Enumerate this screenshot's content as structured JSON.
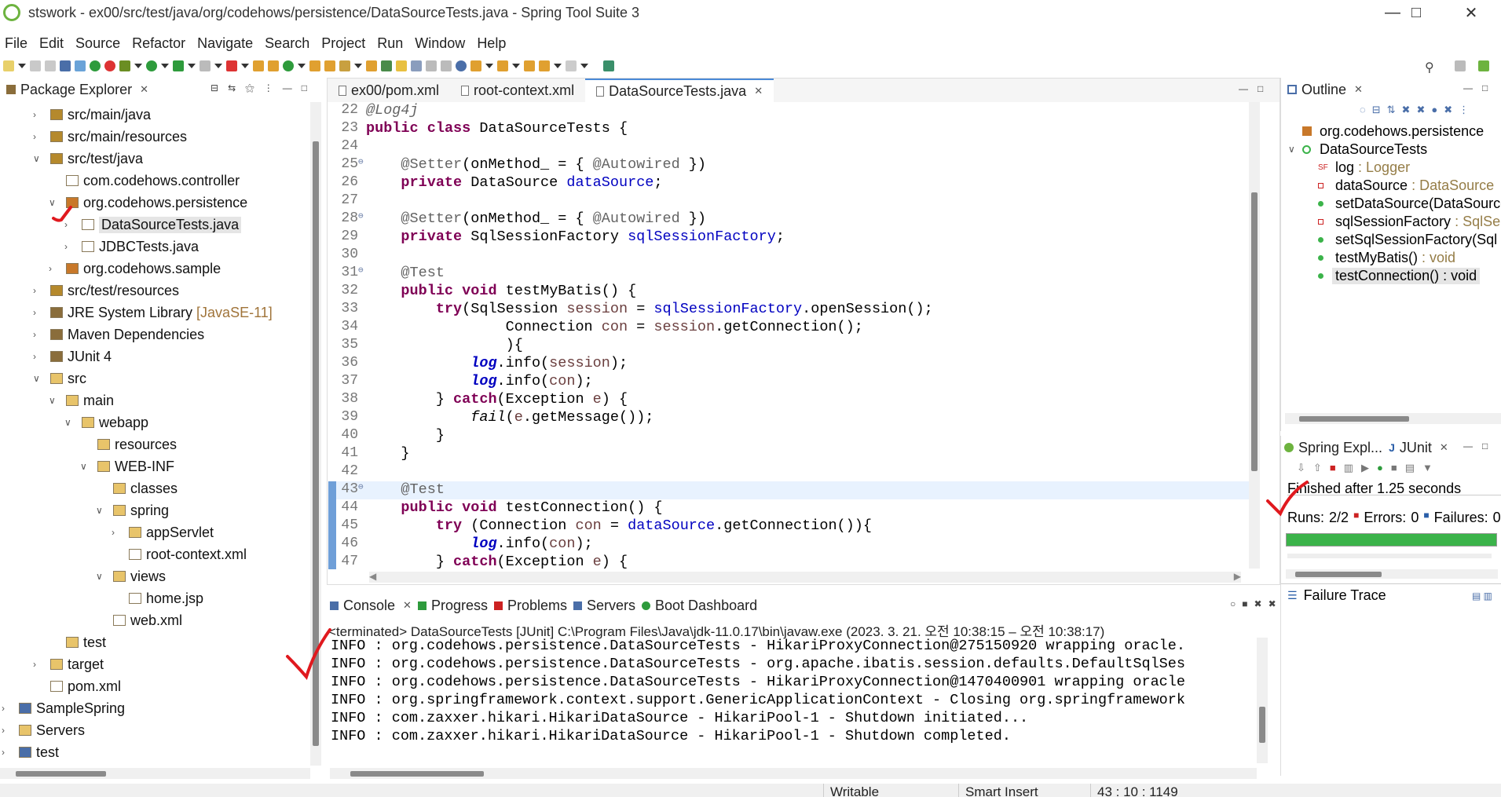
{
  "window": {
    "title": "stswork - ex00/src/test/java/org/codehows/persistence/DataSourceTests.java - Spring Tool Suite 3"
  },
  "menu": [
    "File",
    "Edit",
    "Source",
    "Refactor",
    "Navigate",
    "Search",
    "Project",
    "Run",
    "Window",
    "Help"
  ],
  "package_explorer": {
    "tab_label": "Package Explorer",
    "items": [
      {
        "label": "src/main/java",
        "indent": 1,
        "expand": "closed",
        "icon": "source-folder-icon"
      },
      {
        "label": "src/main/resources",
        "indent": 1,
        "expand": "closed",
        "icon": "source-folder-icon"
      },
      {
        "label": "src/test/java",
        "indent": 1,
        "expand": "open",
        "icon": "source-folder-icon"
      },
      {
        "label": "com.codehows.controller",
        "indent": 2,
        "expand": "none",
        "icon": "empty-package-icon"
      },
      {
        "label": "org.codehows.persistence",
        "indent": 2,
        "expand": "open",
        "icon": "package-icon"
      },
      {
        "label": "DataSourceTests.java",
        "indent": 3,
        "expand": "closed",
        "icon": "java-file-icon",
        "selected": true
      },
      {
        "label": "JDBCTests.java",
        "indent": 3,
        "expand": "closed",
        "icon": "java-file-icon"
      },
      {
        "label": "org.codehows.sample",
        "indent": 2,
        "expand": "closed",
        "icon": "package-icon"
      },
      {
        "label": "src/test/resources",
        "indent": 1,
        "expand": "closed",
        "icon": "source-folder-icon"
      },
      {
        "label": "JRE System Library",
        "decoration": "[JavaSE-11]",
        "indent": 1,
        "expand": "closed",
        "icon": "library-icon"
      },
      {
        "label": "Maven Dependencies",
        "indent": 1,
        "expand": "closed",
        "icon": "library-icon"
      },
      {
        "label": "JUnit 4",
        "indent": 1,
        "expand": "closed",
        "icon": "library-icon"
      },
      {
        "label": "src",
        "indent": 1,
        "expand": "open",
        "icon": "folder-icon"
      },
      {
        "label": "main",
        "indent": 2,
        "expand": "open",
        "icon": "folder-icon"
      },
      {
        "label": "webapp",
        "indent": 3,
        "expand": "open",
        "icon": "folder-icon"
      },
      {
        "label": "resources",
        "indent": 4,
        "expand": "none",
        "icon": "folder-icon"
      },
      {
        "label": "WEB-INF",
        "indent": 4,
        "expand": "open",
        "icon": "folder-icon"
      },
      {
        "label": "classes",
        "indent": 5,
        "expand": "none",
        "icon": "folder-icon"
      },
      {
        "label": "spring",
        "indent": 5,
        "expand": "open",
        "icon": "folder-icon"
      },
      {
        "label": "appServlet",
        "indent": 6,
        "expand": "closed",
        "icon": "folder-icon"
      },
      {
        "label": "root-context.xml",
        "indent": 6,
        "expand": "none",
        "icon": "xml-file-icon"
      },
      {
        "label": "views",
        "indent": 5,
        "expand": "open",
        "icon": "folder-icon"
      },
      {
        "label": "home.jsp",
        "indent": 6,
        "expand": "none",
        "icon": "jsp-file-icon"
      },
      {
        "label": "web.xml",
        "indent": 5,
        "expand": "none",
        "icon": "xml-file-icon"
      },
      {
        "label": "test",
        "indent": 2,
        "expand": "none",
        "icon": "folder-icon"
      },
      {
        "label": "target",
        "indent": 1,
        "expand": "closed",
        "icon": "folder-icon"
      },
      {
        "label": "pom.xml",
        "indent": 1,
        "expand": "none",
        "icon": "xml-file-icon"
      },
      {
        "label": "SampleSpring",
        "indent": 0,
        "expand": "closed",
        "icon": "project-icon"
      },
      {
        "label": "Servers",
        "indent": 0,
        "expand": "closed",
        "icon": "folder-icon"
      },
      {
        "label": "test",
        "indent": 0,
        "expand": "closed",
        "icon": "project-icon"
      }
    ]
  },
  "editor": {
    "tabs": [
      {
        "label": "ex00/pom.xml",
        "icon": "xml-file-icon"
      },
      {
        "label": "root-context.xml",
        "icon": "xml-file-icon"
      },
      {
        "label": "DataSourceTests.java",
        "icon": "java-file-icon",
        "active": true
      }
    ],
    "lines": [
      {
        "n": "22",
        "fold": "",
        "parts": [
          [
            "ann ital",
            "@Log4j"
          ]
        ]
      },
      {
        "n": "23",
        "fold": "",
        "parts": [
          [
            "kw",
            "public"
          ],
          [
            "",
            "&nbsp;"
          ],
          [
            "kw",
            "class"
          ],
          [
            "",
            "&nbsp;DataSourceTests {"
          ]
        ]
      },
      {
        "n": "24",
        "fold": "",
        "parts": []
      },
      {
        "n": "25",
        "fold": "⊖",
        "parts": [
          [
            "",
            "    "
          ],
          [
            "ann",
            "@Setter"
          ],
          [
            "",
            "(onMethod_ = { "
          ],
          [
            "ann",
            "@Autowired"
          ],
          [
            "",
            " })"
          ]
        ]
      },
      {
        "n": "26",
        "fold": "",
        "parts": [
          [
            "",
            "    "
          ],
          [
            "kw",
            "private"
          ],
          [
            "",
            " DataSource "
          ],
          [
            "fld",
            "dataSource"
          ],
          [
            "",
            ";"
          ]
        ]
      },
      {
        "n": "27",
        "fold": "",
        "parts": []
      },
      {
        "n": "28",
        "fold": "⊖",
        "parts": [
          [
            "",
            "    "
          ],
          [
            "ann",
            "@Setter"
          ],
          [
            "",
            "(onMethod_ = { "
          ],
          [
            "ann",
            "@Autowired"
          ],
          [
            "",
            " })"
          ]
        ]
      },
      {
        "n": "29",
        "fold": "",
        "parts": [
          [
            "",
            "    "
          ],
          [
            "kw",
            "private"
          ],
          [
            "",
            " SqlSessionFactory "
          ],
          [
            "fld",
            "sqlSessionFactory"
          ],
          [
            "",
            ";"
          ]
        ]
      },
      {
        "n": "30",
        "fold": "",
        "parts": []
      },
      {
        "n": "31",
        "fold": "⊖",
        "parts": [
          [
            "",
            "    "
          ],
          [
            "ann",
            "@Test"
          ]
        ]
      },
      {
        "n": "32",
        "fold": "",
        "parts": [
          [
            "",
            "    "
          ],
          [
            "kw",
            "public"
          ],
          [
            "",
            " "
          ],
          [
            "kw",
            "void"
          ],
          [
            "",
            " testMyBatis() {"
          ]
        ]
      },
      {
        "n": "33",
        "fold": "",
        "parts": [
          [
            "",
            "        "
          ],
          [
            "kw",
            "try"
          ],
          [
            "",
            "(SqlSession "
          ],
          [
            "local",
            "session"
          ],
          [
            "",
            " = "
          ],
          [
            "fld",
            "sqlSessionFactory"
          ],
          [
            "",
            ".openSession();"
          ]
        ]
      },
      {
        "n": "34",
        "fold": "",
        "parts": [
          [
            "",
            "                Connection "
          ],
          [
            "local",
            "con"
          ],
          [
            "",
            " = "
          ],
          [
            "local",
            "session"
          ],
          [
            "",
            ".getConnection();"
          ]
        ]
      },
      {
        "n": "35",
        "fold": "",
        "parts": [
          [
            "",
            "                ){"
          ]
        ]
      },
      {
        "n": "36",
        "fold": "",
        "parts": [
          [
            "",
            "            "
          ],
          [
            "stat",
            "log"
          ],
          [
            "",
            ".info("
          ],
          [
            "local",
            "session"
          ],
          [
            "",
            ");"
          ]
        ]
      },
      {
        "n": "37",
        "fold": "",
        "parts": [
          [
            "",
            "            "
          ],
          [
            "stat",
            "log"
          ],
          [
            "",
            ".info("
          ],
          [
            "local",
            "con"
          ],
          [
            "",
            ");"
          ]
        ]
      },
      {
        "n": "38",
        "fold": "",
        "parts": [
          [
            "",
            "        } "
          ],
          [
            "kw",
            "catch"
          ],
          [
            "",
            "(Exception "
          ],
          [
            "local",
            "e"
          ],
          [
            "",
            ") {"
          ]
        ]
      },
      {
        "n": "39",
        "fold": "",
        "parts": [
          [
            "",
            "            "
          ],
          [
            "ital",
            "fail"
          ],
          [
            "",
            "("
          ],
          [
            "local",
            "e"
          ],
          [
            "",
            ".getMessage());"
          ]
        ]
      },
      {
        "n": "40",
        "fold": "",
        "parts": [
          [
            "",
            "        }"
          ]
        ]
      },
      {
        "n": "41",
        "fold": "",
        "parts": [
          [
            "",
            "    }"
          ]
        ]
      },
      {
        "n": "42",
        "fold": "",
        "parts": []
      },
      {
        "n": "43",
        "fold": "⊖",
        "current": true,
        "parts": [
          [
            "",
            "    "
          ],
          [
            "ann",
            "@Test"
          ]
        ]
      },
      {
        "n": "44",
        "fold": "",
        "parts": [
          [
            "",
            "    "
          ],
          [
            "kw",
            "public"
          ],
          [
            "",
            " "
          ],
          [
            "kw",
            "void"
          ],
          [
            "",
            " testConnection() {"
          ]
        ]
      },
      {
        "n": "45",
        "fold": "",
        "parts": [
          [
            "",
            "        "
          ],
          [
            "kw",
            "try"
          ],
          [
            "",
            " (Connection "
          ],
          [
            "local",
            "con"
          ],
          [
            "",
            " = "
          ],
          [
            "fld",
            "dataSource"
          ],
          [
            "",
            ".getConnection()){"
          ]
        ]
      },
      {
        "n": "46",
        "fold": "",
        "parts": [
          [
            "",
            "            "
          ],
          [
            "stat",
            "log"
          ],
          [
            "",
            ".info("
          ],
          [
            "local",
            "con"
          ],
          [
            "",
            ");"
          ]
        ]
      },
      {
        "n": "47",
        "fold": "",
        "parts": [
          [
            "",
            "        } "
          ],
          [
            "kw",
            "catch"
          ],
          [
            "",
            "(Exception "
          ],
          [
            "local",
            "e"
          ],
          [
            "",
            ") {"
          ]
        ]
      }
    ]
  },
  "console": {
    "tabs": [
      "Console",
      "Progress",
      "Problems",
      "Servers",
      "Boot Dashboard"
    ],
    "status": "<terminated> DataSourceTests [JUnit] C:\\Program Files\\Java\\jdk-11.0.17\\bin\\javaw.exe  (2023. 3. 21. 오전 10:38:15 – 오전 10:38:17)",
    "lines": [
      "INFO : org.codehows.persistence.DataSourceTests - HikariProxyConnection@275150920 wrapping oracle.",
      "INFO : org.codehows.persistence.DataSourceTests - org.apache.ibatis.session.defaults.DefaultSqlSes",
      "INFO : org.codehows.persistence.DataSourceTests - HikariProxyConnection@1470400901 wrapping oracle",
      "INFO : org.springframework.context.support.GenericApplicationContext - Closing org.springframework",
      "INFO : com.zaxxer.hikari.HikariDataSource - HikariPool-1 - Shutdown initiated...",
      "INFO : com.zaxxer.hikari.HikariDataSource - HikariPool-1 - Shutdown completed."
    ]
  },
  "outline": {
    "tab_label": "Outline",
    "items": [
      {
        "label": "org.codehows.persistence",
        "type": "",
        "icon": "package-icon",
        "indent": 0
      },
      {
        "label": "DataSourceTests",
        "type": "",
        "icon": "class-icon",
        "indent": 0,
        "expand": "open"
      },
      {
        "label": "log",
        "type": " : Logger",
        "icon": "static-field-icon",
        "indent": 1
      },
      {
        "label": "dataSource",
        "type": " : DataSource",
        "icon": "private-field-icon",
        "indent": 1
      },
      {
        "label": "setDataSource(DataSource",
        "type": "",
        "icon": "public-method-icon",
        "indent": 1
      },
      {
        "label": "sqlSessionFactory",
        "type": " : SqlSe",
        "icon": "private-field-icon",
        "indent": 1
      },
      {
        "label": "setSqlSessionFactory(Sql",
        "type": "",
        "icon": "public-method-icon",
        "indent": 1
      },
      {
        "label": "testMyBatis()",
        "type": " : void",
        "icon": "public-method-icon",
        "indent": 1
      },
      {
        "label": "testConnection() : void",
        "type": "",
        "icon": "public-method-icon",
        "indent": 1,
        "selected": true
      }
    ]
  },
  "junit": {
    "tabs": [
      "Spring Expl...",
      "JUnit"
    ],
    "finished": "Finished after 1.25 seconds",
    "runs_label": "Runs:",
    "runs_value": "2/2",
    "errors_label": "Errors:",
    "errors_value": "0",
    "failures_label": "Failures:",
    "failures_value": "0",
    "progress": 1.0,
    "failure_trace_label": "Failure Trace"
  },
  "statusbar": {
    "mode": "Writable",
    "insert": "Smart Insert",
    "position": "43 : 10 : 1149"
  },
  "colors": {
    "progress_green": "#3bb34a",
    "annotation_red": "#e0191e",
    "keyword": "#7f0055",
    "field": "#0000c0"
  }
}
